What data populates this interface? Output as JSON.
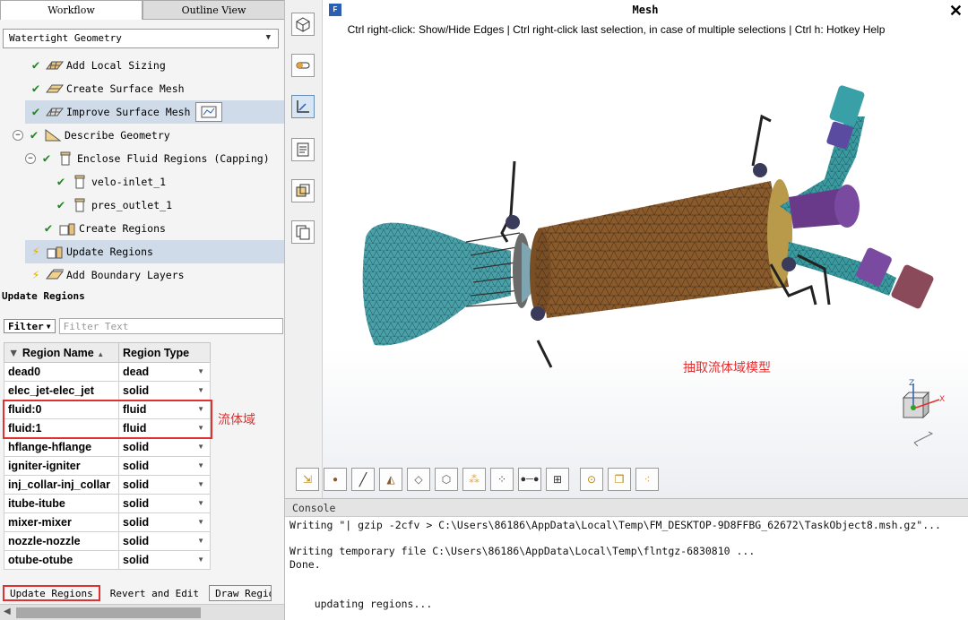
{
  "tabs": {
    "workflow": "Workflow",
    "outline": "Outline View"
  },
  "workflow_select": {
    "value": "Watertight Geometry"
  },
  "tree": [
    {
      "label": "Add Local Sizing",
      "status": "done"
    },
    {
      "label": "Create Surface Mesh",
      "status": "done"
    },
    {
      "label": "Improve Surface Mesh",
      "status": "done"
    },
    {
      "label": "Describe Geometry",
      "status": "done"
    },
    {
      "label": "Enclose Fluid Regions (Capping)",
      "status": "done"
    },
    {
      "label": "velo-inlet_1",
      "status": "done"
    },
    {
      "label": "pres_outlet_1",
      "status": "done"
    },
    {
      "label": "Create Regions",
      "status": "done"
    },
    {
      "label": "Update Regions",
      "status": "pending"
    },
    {
      "label": "Add Boundary Layers",
      "status": "pending"
    }
  ],
  "update_panel": {
    "title": "Update Regions",
    "filter_label": "Filter",
    "filter_placeholder": "Filter Text",
    "col_name": "Region Name",
    "col_type": "Region Type",
    "rows": [
      {
        "name": "dead0",
        "type": "dead"
      },
      {
        "name": "elec_jet-elec_jet",
        "type": "solid"
      },
      {
        "name": "fluid:0",
        "type": "fluid"
      },
      {
        "name": "fluid:1",
        "type": "fluid"
      },
      {
        "name": "hflange-hflange",
        "type": "solid"
      },
      {
        "name": "igniter-igniter",
        "type": "solid"
      },
      {
        "name": "inj_collar-inj_collar",
        "type": "solid"
      },
      {
        "name": "itube-itube",
        "type": "solid"
      },
      {
        "name": "mixer-mixer",
        "type": "solid"
      },
      {
        "name": "nozzle-nozzle",
        "type": "solid"
      },
      {
        "name": "otube-otube",
        "type": "solid"
      }
    ],
    "buttons": {
      "update": "Update Regions",
      "revert": "Revert and Edit",
      "draw": "Draw Regions"
    }
  },
  "annotations": {
    "fluid_domain": "流体域",
    "extract_model": "抽取流体域模型"
  },
  "viewer": {
    "title": "Mesh",
    "help": "Ctrl right-click: Show/Hide Edges | Ctrl right-click last selection, in case of multiple selections | Ctrl h: Hotkey Help"
  },
  "console": {
    "title": "Console",
    "lines": [
      "Writing \"| gzip -2cfv > C:\\Users\\86186\\AppData\\Local\\Temp\\FM_DESKTOP-9D8FFBG_62672\\TaskObject8.msh.gz\"...",
      "Writing temporary file C:\\Users\\86186\\AppData\\Local\\Temp\\flntgz-6830810 ...",
      "Done.",
      "    updating regions..."
    ]
  },
  "colors": {
    "done": "#1c8a1c",
    "pending": "#e4b000",
    "highlight": "#e03030",
    "selected_row": "#cfdbe8",
    "mesh_body": "#8a5a2b",
    "mesh_nozzle": "#4aa0a8"
  }
}
